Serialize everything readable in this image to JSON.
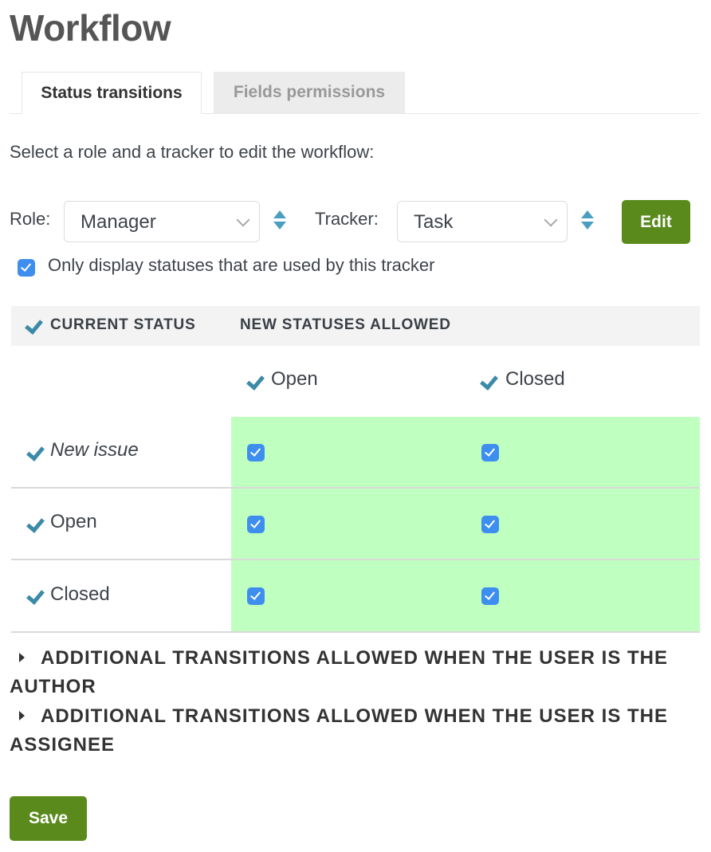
{
  "page": {
    "title": "Workflow"
  },
  "tabs": [
    {
      "label": "Status transitions",
      "active": true
    },
    {
      "label": "Fields permissions",
      "active": false
    }
  ],
  "instructions": "Select a role and a tracker to edit the workflow:",
  "filters": {
    "role_label": "Role:",
    "role_value": "Manager",
    "tracker_label": "Tracker:",
    "tracker_value": "Task",
    "edit_label": "Edit",
    "only_used_statuses_label": "Only display statuses that are used by this tracker",
    "only_used_statuses_checked": true
  },
  "table": {
    "header_current": "CURRENT STATUS",
    "header_new": "NEW STATUSES ALLOWED",
    "columns": [
      "Open",
      "Closed"
    ],
    "rows": [
      {
        "label": "New issue",
        "italic": true,
        "allowed": [
          true,
          true
        ]
      },
      {
        "label": "Open",
        "italic": false,
        "allowed": [
          true,
          true
        ]
      },
      {
        "label": "Closed",
        "italic": false,
        "allowed": [
          true,
          true
        ]
      }
    ],
    "highlight_color": "#bfffbf"
  },
  "additional": [
    {
      "label": "ADDITIONAL TRANSITIONS ALLOWED WHEN THE USER IS THE AUTHOR"
    },
    {
      "label": "ADDITIONAL TRANSITIONS ALLOWED WHEN THE USER IS THE ASSIGNEE"
    }
  ],
  "save_label": "Save",
  "colors": {
    "accent_green": "#5a8a1c",
    "checkbox_blue": "#3e8ef0",
    "tick_blue": "#3b8aa7"
  }
}
